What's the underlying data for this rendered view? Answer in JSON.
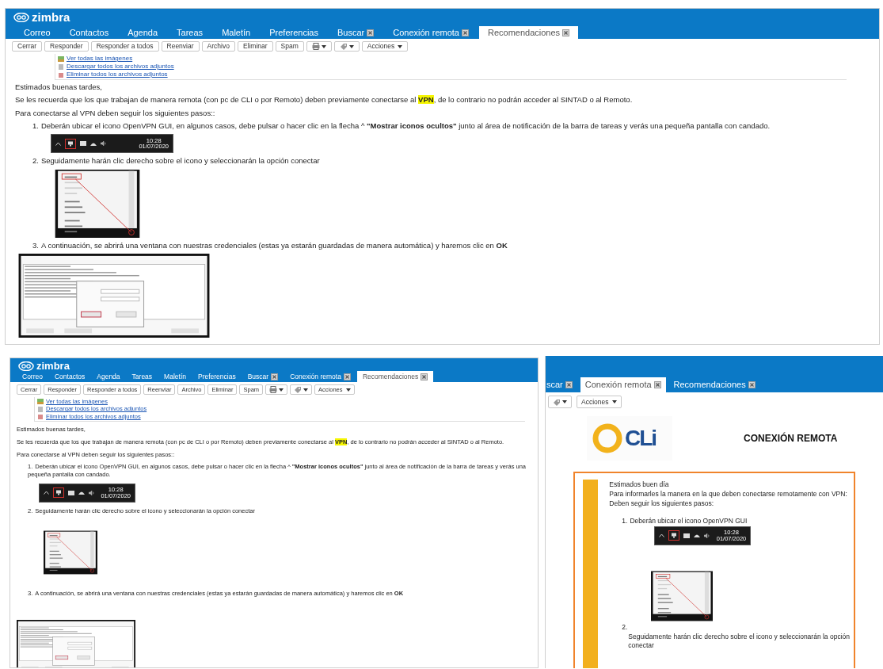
{
  "panels": [
    {
      "kind": "message",
      "logo": "zimbra",
      "tabs": [
        {
          "label": "Correo",
          "closable": false,
          "selected": false
        },
        {
          "label": "Contactos",
          "closable": false,
          "selected": false
        },
        {
          "label": "Agenda",
          "closable": false,
          "selected": false
        },
        {
          "label": "Tareas",
          "closable": false,
          "selected": false
        },
        {
          "label": "Maletín",
          "closable": false,
          "selected": false
        },
        {
          "label": "Preferencias",
          "closable": false,
          "selected": false
        },
        {
          "label": "Buscar",
          "closable": true,
          "selected": false
        },
        {
          "label": "Conexión remota",
          "closable": true,
          "selected": false
        },
        {
          "label": "Recomendaciones",
          "closable": true,
          "selected": true
        }
      ],
      "toolbar": [
        {
          "kind": "text",
          "label": "Cerrar"
        },
        {
          "kind": "text",
          "label": "Responder"
        },
        {
          "kind": "text",
          "label": "Responder a todos"
        },
        {
          "kind": "text",
          "label": "Reenviar"
        },
        {
          "kind": "text",
          "label": "Archivo"
        },
        {
          "kind": "text",
          "label": "Eliminar"
        },
        {
          "kind": "text",
          "label": "Spam"
        },
        {
          "kind": "print"
        },
        {
          "kind": "tag"
        },
        {
          "kind": "menu",
          "label": "Acciones"
        }
      ],
      "attachment_links": [
        {
          "kind": "images",
          "label": "Ver todas las imágenes"
        },
        {
          "kind": "download",
          "label": "Descargar todos los archivos adjuntos"
        },
        {
          "kind": "delete",
          "label": "Eliminar todos los archivos adjuntos"
        }
      ],
      "body": [
        {
          "kind": "paragraph",
          "text": "Estimados buenas tardes,"
        },
        {
          "kind": "paragraph",
          "text": "Se les recuerda que los que trabajan de manera remota (con pc de CLI o por Remoto) deben previamente conectarse al **VPN**, de lo contrario no podrán acceder al SINTAD o al Remoto."
        },
        {
          "kind": "paragraph",
          "text": "Para conectarse al VPN deben seguir los siguientes pasos::"
        },
        {
          "kind": "step",
          "number": "1.",
          "text": "Deberán ubicar el icono OpenVPN GUI, en algunos casos, debe pulsar o hacer clic en la flecha ^ **\"Mostrar iconos ocultos\"** junto al área de notificación de la barra de tareas y verás una pequeña pantalla con candado."
        },
        {
          "kind": "tray",
          "time": "10:28",
          "date": "01/07/2020"
        },
        {
          "kind": "step",
          "number": "2.",
          "text": "Seguidamente harán clic derecho sobre el icono y seleccionarán la opción conectar"
        },
        {
          "kind": "menu"
        },
        {
          "kind": "step",
          "number": "3.",
          "text": "A continuación, se abrirá una ventana con nuestras credenciales (estas ya estarán guardadas de manera automática) y haremos clic en **OK**"
        },
        {
          "kind": "dialog"
        }
      ]
    },
    {
      "kind": "message",
      "logo": "zimbra",
      "tabs": [
        {
          "label": "Correo",
          "closable": false,
          "selected": false
        },
        {
          "label": "Contactos",
          "closable": false,
          "selected": false
        },
        {
          "label": "Agenda",
          "closable": false,
          "selected": false
        },
        {
          "label": "Tareas",
          "closable": false,
          "selected": false
        },
        {
          "label": "Maletín",
          "closable": false,
          "selected": false
        },
        {
          "label": "Preferencias",
          "closable": false,
          "selected": false
        },
        {
          "label": "Buscar",
          "closable": true,
          "selected": false
        },
        {
          "label": "Conexión remota",
          "closable": true,
          "selected": false
        },
        {
          "label": "Recomendaciones",
          "closable": true,
          "selected": true
        }
      ],
      "toolbar": [
        {
          "kind": "text",
          "label": "Cerrar"
        },
        {
          "kind": "text",
          "label": "Responder"
        },
        {
          "kind": "text",
          "label": "Responder a todos"
        },
        {
          "kind": "text",
          "label": "Reenviar"
        },
        {
          "kind": "text",
          "label": "Archivo"
        },
        {
          "kind": "text",
          "label": "Eliminar"
        },
        {
          "kind": "text",
          "label": "Spam"
        },
        {
          "kind": "print"
        },
        {
          "kind": "tag"
        },
        {
          "kind": "menu",
          "label": "Acciones"
        }
      ],
      "attachment_links": [
        {
          "kind": "images",
          "label": "Ver todas las imágenes"
        },
        {
          "kind": "download",
          "label": "Descargar todos los archivos adjuntos"
        },
        {
          "kind": "delete",
          "label": "Eliminar todos los archivos adjuntos"
        }
      ],
      "body": [
        {
          "kind": "paragraph",
          "text": "Estimados buenas tardes,"
        },
        {
          "kind": "paragraph",
          "text": "Se les recuerda que los que trabajan de manera remota (con pc de CLI o por Remoto) deben previamente conectarse al **VPN**, de lo contrario no podrán acceder al SINTAD o al Remoto."
        },
        {
          "kind": "paragraph",
          "text": "Para conectarse al VPN deben seguir los siguientes pasos::"
        },
        {
          "kind": "step",
          "number": "1.",
          "text": "Deberán ubicar el icono OpenVPN GUI, en algunos casos, debe pulsar o hacer clic en la flecha ^ **\"Mostrar iconos ocultos\"** junto al área de notificación de la barra de tareas y verás una pequeña pantalla con candado."
        },
        {
          "kind": "tray",
          "time": "10:28",
          "date": "01/07/2020"
        },
        {
          "kind": "step",
          "number": "2.",
          "text": "Seguidamente harán clic derecho sobre el icono y seleccionarán la opción conectar"
        },
        {
          "kind": "menu"
        },
        {
          "kind": "step",
          "number": "3.",
          "text": "A continuación, se abrirá una ventana con nuestras credenciales (estas ya estarán guardadas de manera automática) y haremos clic en **OK**"
        },
        {
          "kind": "dialog"
        }
      ]
    },
    {
      "kind": "newsletter",
      "tabs": [
        {
          "label": "scar",
          "closable": true,
          "selected": false
        },
        {
          "label": "Conexión remota",
          "closable": true,
          "selected": true
        },
        {
          "label": "Recomendaciones",
          "closable": true,
          "selected": false
        }
      ],
      "toolbar": [
        {
          "kind": "tag"
        },
        {
          "kind": "menu",
          "label": "Acciones"
        }
      ],
      "logo_text": "CLi",
      "title": "CONEXIÓN REMOTA",
      "body": [
        {
          "kind": "line",
          "text": "Estimados buen día"
        },
        {
          "kind": "line",
          "text": "Para informarles la manera en la que deben conectarse remotamente con VPN:"
        },
        {
          "kind": "line",
          "text": "Deben seguir los siguientes pasos:"
        },
        {
          "kind": "step",
          "number": "1.",
          "text": "Deberán ubicar el icono OpenVPN GUI"
        },
        {
          "kind": "tray",
          "time": "10:28",
          "date": "01/07/2020"
        },
        {
          "kind": "menu-step",
          "number": "2.",
          "text": "Seguidamente harán clic derecho sobre el icono y seleccionarán la opción conectar"
        }
      ]
    }
  ]
}
